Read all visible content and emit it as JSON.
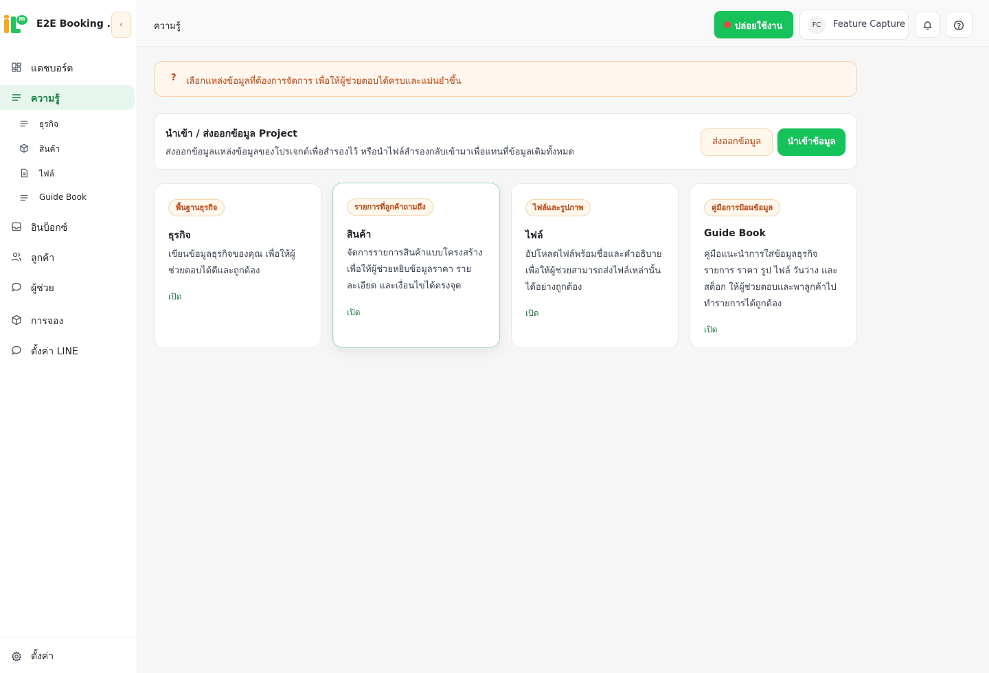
{
  "app": {
    "name": "E2E Booking ...",
    "logo_text": "m"
  },
  "sidebar": {
    "items": [
      {
        "label": "แดชบอร์ด",
        "icon": "dashboard-icon"
      },
      {
        "label": "ความรู้",
        "icon": "list-icon",
        "active": true
      },
      {
        "label": "อินบ็อกซ์",
        "icon": "inbox-icon"
      },
      {
        "label": "ลูกค้า",
        "icon": "users-icon"
      },
      {
        "label": "ผู้ช่วย",
        "icon": "chat-icon"
      },
      {
        "label": "การจอง",
        "icon": "box-icon"
      },
      {
        "label": "ตั้งค่า LINE",
        "icon": "chat-icon"
      }
    ],
    "sub_items": [
      {
        "label": "ธุรกิจ",
        "icon": "list-icon"
      },
      {
        "label": "สินค้า",
        "icon": "box-icon"
      },
      {
        "label": "ไฟล์",
        "icon": "file-icon"
      },
      {
        "label": "Guide Book",
        "icon": "list-icon"
      }
    ],
    "footer": {
      "label": "ตั้งค่า",
      "icon": "gear-icon"
    }
  },
  "header": {
    "breadcrumb": "ความรู้",
    "release_label": "ปล่อยใช้งาน",
    "user_initials": "FC",
    "user_name": "Feature Capture"
  },
  "notice": {
    "icon": "?",
    "text": "เลือกแหล่งข้อมูลที่ต้องการจัดการ เพื่อให้ผู้ช่วยตอบได้ครบและแม่นยำขึ้น"
  },
  "io_card": {
    "title": "นำเข้า / ส่งออกข้อมูล Project",
    "description": "ส่งออกข้อมูลแหล่งข้อมูลของโปรเจกต์เพื่อสำรองไว้ หรือนำไฟล์สำรองกลับเข้ามาเพื่อแทนที่ข้อมูลเดิมทั้งหมด",
    "export_label": "ส่งออกข้อมูล",
    "import_label": "นำเข้าข้อมูล"
  },
  "cards": [
    {
      "tag": "พื้นฐานธุรกิจ",
      "title": "ธุรกิจ",
      "description": "เขียนข้อมูลธุรกิจของคุณ เพื่อให้ผู้ช่วยตอบได้ดีและถูกต้อง",
      "link": "เปิด"
    },
    {
      "tag": "รายการที่ลูกค้าถามถึง",
      "title": "สินค้า",
      "description": "จัดการรายการสินค้าแบบโครงสร้าง เพื่อให้ผู้ช่วยหยิบข้อมูลราคา รายละเอียด และเงื่อนไขได้ตรงจุด",
      "link": "เปิด"
    },
    {
      "tag": "ไฟล์และรูปภาพ",
      "title": "ไฟล์",
      "description": "อัปโหลดไฟล์พร้อมชื่อและคำอธิบาย เพื่อให้ผู้ช่วยสามารถส่งไฟล์เหล่านั้นได้อย่างถูกต้อง",
      "link": "เปิด"
    },
    {
      "tag": "คู่มือการป้อนข้อมูล",
      "title": "Guide Book",
      "description": "คู่มือแนะนำการใส่ข้อมูลธุรกิจ รายการ ราคา รูป ไฟล์ วันว่าง และสต็อก ให้ผู้ช่วยตอบและพาลูกค้าไปทำรายการได้ถูกต้อง",
      "link": "เปิด"
    }
  ],
  "colors": {
    "accent": "#16c25a",
    "warning": "#c2410c",
    "active_bg": "#e6f6ec"
  }
}
